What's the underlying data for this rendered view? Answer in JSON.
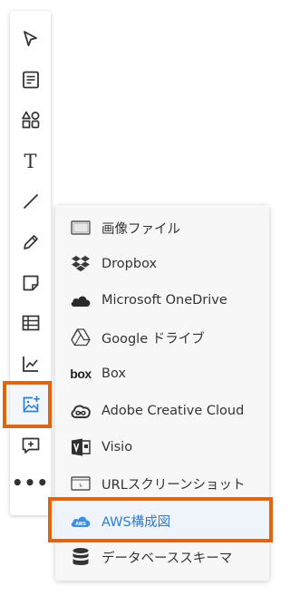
{
  "toolbar": {
    "tools": [
      {
        "icon": "pointer-arrow-icon"
      },
      {
        "icon": "note-card-icon"
      },
      {
        "icon": "shapes-icon"
      },
      {
        "icon": "text-tool-icon",
        "glyph": "T"
      },
      {
        "icon": "line-tool-icon"
      },
      {
        "icon": "pencil-icon"
      },
      {
        "icon": "sticky-note-icon"
      },
      {
        "icon": "table-icon"
      },
      {
        "icon": "chart-icon"
      },
      {
        "icon": "image-plus-icon",
        "selected": true
      },
      {
        "icon": "comment-add-icon"
      },
      {
        "icon": "more-icon",
        "glyph": "•••"
      }
    ]
  },
  "menu": {
    "items": [
      {
        "label": "画像ファイル",
        "icon": "image-file-icon"
      },
      {
        "label": "Dropbox",
        "icon": "dropbox-icon"
      },
      {
        "label": "Microsoft OneDrive",
        "icon": "onedrive-cloud-icon"
      },
      {
        "label": "Google ドライブ",
        "icon": "google-drive-icon"
      },
      {
        "label": "Box",
        "icon": "box-logo-icon",
        "logo_text": "box"
      },
      {
        "label": "Adobe Creative Cloud",
        "icon": "adobe-creative-cloud-icon"
      },
      {
        "label": "Visio",
        "icon": "visio-icon"
      },
      {
        "label": "URLスクリーンショット",
        "icon": "url-screenshot-icon"
      },
      {
        "label": "AWS構成図",
        "icon": "aws-cloud-icon",
        "active": true,
        "logo_text": "AWS"
      },
      {
        "label": "データベーススキーマ",
        "icon": "database-icon"
      }
    ]
  },
  "colors": {
    "highlight": "#e4630d",
    "active_text": "#2e7fd0",
    "aws_icon": "#3d8fe0"
  }
}
